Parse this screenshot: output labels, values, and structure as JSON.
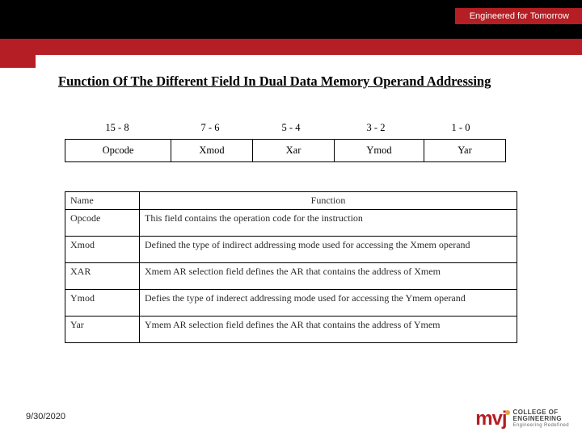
{
  "header": {
    "tagline": "Engineered for Tomorrow"
  },
  "title": "Function Of The Different Field In Dual Data Memory Operand Addressing",
  "bits": {
    "ranges": [
      "15 - 8",
      "7 - 6",
      "5 - 4",
      "3 - 2",
      "1 - 0"
    ],
    "names": [
      "Opcode",
      "Xmod",
      "Xar",
      "Ymod",
      "Yar"
    ]
  },
  "func": {
    "headers": [
      "Name",
      "Function"
    ],
    "rows": [
      {
        "name": "Opcode",
        "desc": "This field contains the operation code for the instruction"
      },
      {
        "name": "Xmod",
        "desc": "Defined the type of indirect addressing mode used for accessing the Xmem operand"
      },
      {
        "name": "XAR",
        "desc": "Xmem AR selection field defines the AR that contains the address of Xmem"
      },
      {
        "name": "Ymod",
        "desc": "Defies the type of inderect addressing mode used for accessing the Ymem operand"
      },
      {
        "name": "Yar",
        "desc": "Ymem AR selection field defines the AR that contains the address of Ymem"
      }
    ]
  },
  "footer": {
    "date": "9/30/2020",
    "logo_main": "mvj",
    "logo_line1": "COLLEGE OF",
    "logo_line2": "ENGINEERING",
    "logo_sub": "Engineering Redefined"
  }
}
